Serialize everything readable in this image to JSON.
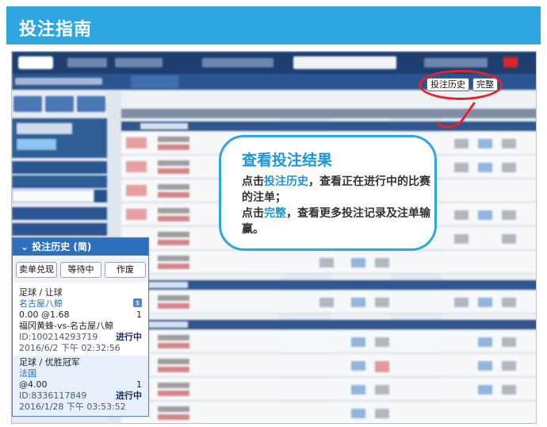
{
  "header": {
    "title": "投注指南"
  },
  "highlight_buttons": {
    "history": "投注历史",
    "complete": "完整"
  },
  "callout": {
    "title": "查看投注结果",
    "line1_pre": "点击",
    "line1_kw": "投注历史",
    "line1_post": "，查看正在进行中的比赛的注单；",
    "line2_pre": "点击",
    "line2_kw": "完整",
    "line2_post": "，查看更多投注记录及注单输赢。"
  },
  "history_panel": {
    "title": "投注历史 (简)",
    "tabs": [
      "卖单兑现",
      "等待中",
      "作废"
    ],
    "bets": [
      {
        "type": "足球 / 让球",
        "team": "名古屋八鲸",
        "odds": "0.00 @1.68",
        "stake": "1",
        "match": "福冈黄蜂-vs-名古屋八鲸",
        "id": "ID:100214293719",
        "status": "进行中",
        "time": "2016/6/2 下午 02:32:56"
      },
      {
        "type": "足球 / 优胜冠军",
        "team": "法国",
        "odds": "@4.00",
        "stake": "1",
        "id": "ID:8336117849",
        "status": "进行中",
        "time": "2016/1/28 下午 03:53:52"
      }
    ]
  },
  "colors": {
    "accent": "#2ea7e0",
    "highlight": "#e5232a",
    "panel_head": "#2b6fbd"
  }
}
